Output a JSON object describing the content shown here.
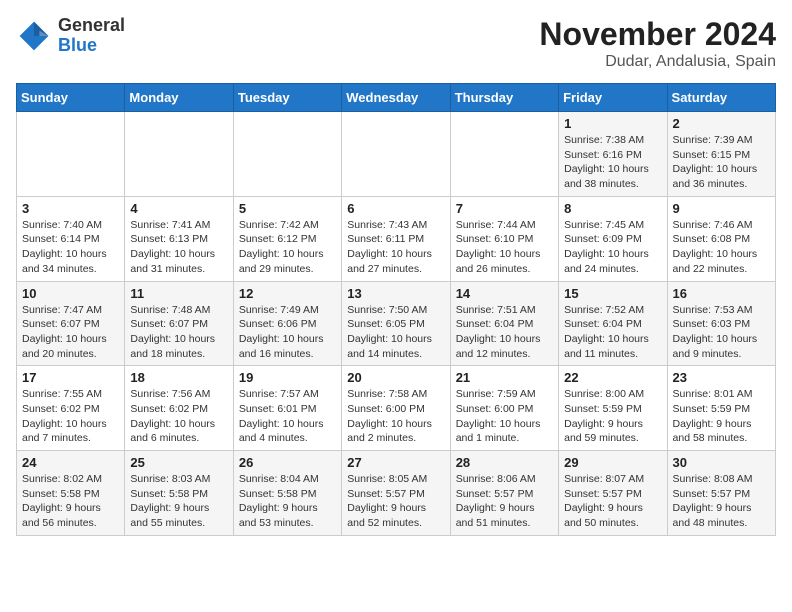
{
  "header": {
    "logo_line1": "General",
    "logo_line2": "Blue",
    "month_title": "November 2024",
    "location": "Dudar, Andalusia, Spain"
  },
  "days_of_week": [
    "Sunday",
    "Monday",
    "Tuesday",
    "Wednesday",
    "Thursday",
    "Friday",
    "Saturday"
  ],
  "weeks": [
    [
      {
        "day": "",
        "info": ""
      },
      {
        "day": "",
        "info": ""
      },
      {
        "day": "",
        "info": ""
      },
      {
        "day": "",
        "info": ""
      },
      {
        "day": "",
        "info": ""
      },
      {
        "day": "1",
        "info": "Sunrise: 7:38 AM\nSunset: 6:16 PM\nDaylight: 10 hours and 38 minutes."
      },
      {
        "day": "2",
        "info": "Sunrise: 7:39 AM\nSunset: 6:15 PM\nDaylight: 10 hours and 36 minutes."
      }
    ],
    [
      {
        "day": "3",
        "info": "Sunrise: 7:40 AM\nSunset: 6:14 PM\nDaylight: 10 hours and 34 minutes."
      },
      {
        "day": "4",
        "info": "Sunrise: 7:41 AM\nSunset: 6:13 PM\nDaylight: 10 hours and 31 minutes."
      },
      {
        "day": "5",
        "info": "Sunrise: 7:42 AM\nSunset: 6:12 PM\nDaylight: 10 hours and 29 minutes."
      },
      {
        "day": "6",
        "info": "Sunrise: 7:43 AM\nSunset: 6:11 PM\nDaylight: 10 hours and 27 minutes."
      },
      {
        "day": "7",
        "info": "Sunrise: 7:44 AM\nSunset: 6:10 PM\nDaylight: 10 hours and 26 minutes."
      },
      {
        "day": "8",
        "info": "Sunrise: 7:45 AM\nSunset: 6:09 PM\nDaylight: 10 hours and 24 minutes."
      },
      {
        "day": "9",
        "info": "Sunrise: 7:46 AM\nSunset: 6:08 PM\nDaylight: 10 hours and 22 minutes."
      }
    ],
    [
      {
        "day": "10",
        "info": "Sunrise: 7:47 AM\nSunset: 6:07 PM\nDaylight: 10 hours and 20 minutes."
      },
      {
        "day": "11",
        "info": "Sunrise: 7:48 AM\nSunset: 6:07 PM\nDaylight: 10 hours and 18 minutes."
      },
      {
        "day": "12",
        "info": "Sunrise: 7:49 AM\nSunset: 6:06 PM\nDaylight: 10 hours and 16 minutes."
      },
      {
        "day": "13",
        "info": "Sunrise: 7:50 AM\nSunset: 6:05 PM\nDaylight: 10 hours and 14 minutes."
      },
      {
        "day": "14",
        "info": "Sunrise: 7:51 AM\nSunset: 6:04 PM\nDaylight: 10 hours and 12 minutes."
      },
      {
        "day": "15",
        "info": "Sunrise: 7:52 AM\nSunset: 6:04 PM\nDaylight: 10 hours and 11 minutes."
      },
      {
        "day": "16",
        "info": "Sunrise: 7:53 AM\nSunset: 6:03 PM\nDaylight: 10 hours and 9 minutes."
      }
    ],
    [
      {
        "day": "17",
        "info": "Sunrise: 7:55 AM\nSunset: 6:02 PM\nDaylight: 10 hours and 7 minutes."
      },
      {
        "day": "18",
        "info": "Sunrise: 7:56 AM\nSunset: 6:02 PM\nDaylight: 10 hours and 6 minutes."
      },
      {
        "day": "19",
        "info": "Sunrise: 7:57 AM\nSunset: 6:01 PM\nDaylight: 10 hours and 4 minutes."
      },
      {
        "day": "20",
        "info": "Sunrise: 7:58 AM\nSunset: 6:00 PM\nDaylight: 10 hours and 2 minutes."
      },
      {
        "day": "21",
        "info": "Sunrise: 7:59 AM\nSunset: 6:00 PM\nDaylight: 10 hours and 1 minute."
      },
      {
        "day": "22",
        "info": "Sunrise: 8:00 AM\nSunset: 5:59 PM\nDaylight: 9 hours and 59 minutes."
      },
      {
        "day": "23",
        "info": "Sunrise: 8:01 AM\nSunset: 5:59 PM\nDaylight: 9 hours and 58 minutes."
      }
    ],
    [
      {
        "day": "24",
        "info": "Sunrise: 8:02 AM\nSunset: 5:58 PM\nDaylight: 9 hours and 56 minutes."
      },
      {
        "day": "25",
        "info": "Sunrise: 8:03 AM\nSunset: 5:58 PM\nDaylight: 9 hours and 55 minutes."
      },
      {
        "day": "26",
        "info": "Sunrise: 8:04 AM\nSunset: 5:58 PM\nDaylight: 9 hours and 53 minutes."
      },
      {
        "day": "27",
        "info": "Sunrise: 8:05 AM\nSunset: 5:57 PM\nDaylight: 9 hours and 52 minutes."
      },
      {
        "day": "28",
        "info": "Sunrise: 8:06 AM\nSunset: 5:57 PM\nDaylight: 9 hours and 51 minutes."
      },
      {
        "day": "29",
        "info": "Sunrise: 8:07 AM\nSunset: 5:57 PM\nDaylight: 9 hours and 50 minutes."
      },
      {
        "day": "30",
        "info": "Sunrise: 8:08 AM\nSunset: 5:57 PM\nDaylight: 9 hours and 48 minutes."
      }
    ]
  ]
}
